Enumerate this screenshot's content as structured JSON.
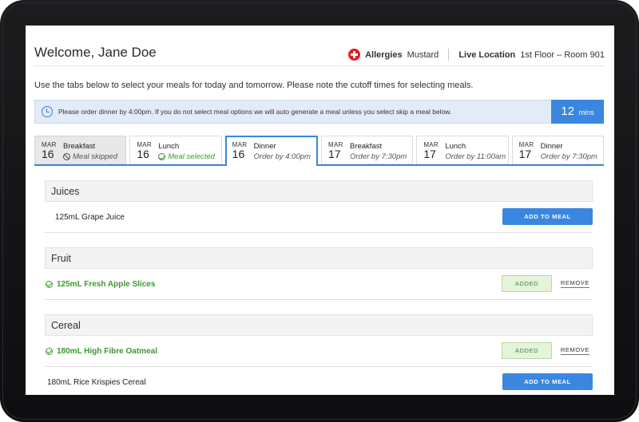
{
  "header": {
    "welcome": "Welcome, Jane Doe",
    "allergies_label": "Allergies",
    "allergies_value": "Mustard",
    "location_label": "Live Location",
    "location_value": "1st Floor – Room 901"
  },
  "instructions": "Use the tabs below to select your meals for today and tomorrow. Please note the cutoff times for selecting meals.",
  "alert": {
    "icon": "clock-icon",
    "text": "Please order dinner by 4:00pm. If you do not select meal options we will auto generate a meal unless you select skip a meal below.",
    "timer_value": "12",
    "timer_unit": "mins"
  },
  "tabs": [
    {
      "month": "MAR",
      "day": "16",
      "meal": "Breakfast",
      "status": "Meal skipped",
      "state": "skipped"
    },
    {
      "month": "MAR",
      "day": "16",
      "meal": "Lunch",
      "status": "Meal selected",
      "state": "selected"
    },
    {
      "month": "MAR",
      "day": "16",
      "meal": "Dinner",
      "status": "Order by 4:00pm",
      "state": "active"
    },
    {
      "month": "MAR",
      "day": "17",
      "meal": "Breakfast",
      "status": "Order by 7:30pm",
      "state": "default"
    },
    {
      "month": "MAR",
      "day": "17",
      "meal": "Lunch",
      "status": "Order by 11:00am",
      "state": "default"
    },
    {
      "month": "MAR",
      "day": "17",
      "meal": "Dinner",
      "status": "Order by 7:30pm",
      "state": "default"
    }
  ],
  "sections": [
    {
      "title": "Juices",
      "items": [
        {
          "name": "125mL Grape Juice",
          "state": "available"
        }
      ]
    },
    {
      "title": "Fruit",
      "items": [
        {
          "name": "125mL Fresh Apple Slices",
          "state": "added"
        }
      ]
    },
    {
      "title": "Cereal",
      "items": [
        {
          "name": "180mL High Fibre Oatmeal",
          "state": "added"
        },
        {
          "name": "180mL Rice Krispies Cereal",
          "state": "available"
        }
      ]
    }
  ],
  "buttons": {
    "add_to_meal": "ADD TO MEAL",
    "added": "ADDED",
    "remove": "REMOVE"
  },
  "colors": {
    "accent": "#3a86e0",
    "success": "#3c9a2e",
    "allergy": "#e02020"
  }
}
